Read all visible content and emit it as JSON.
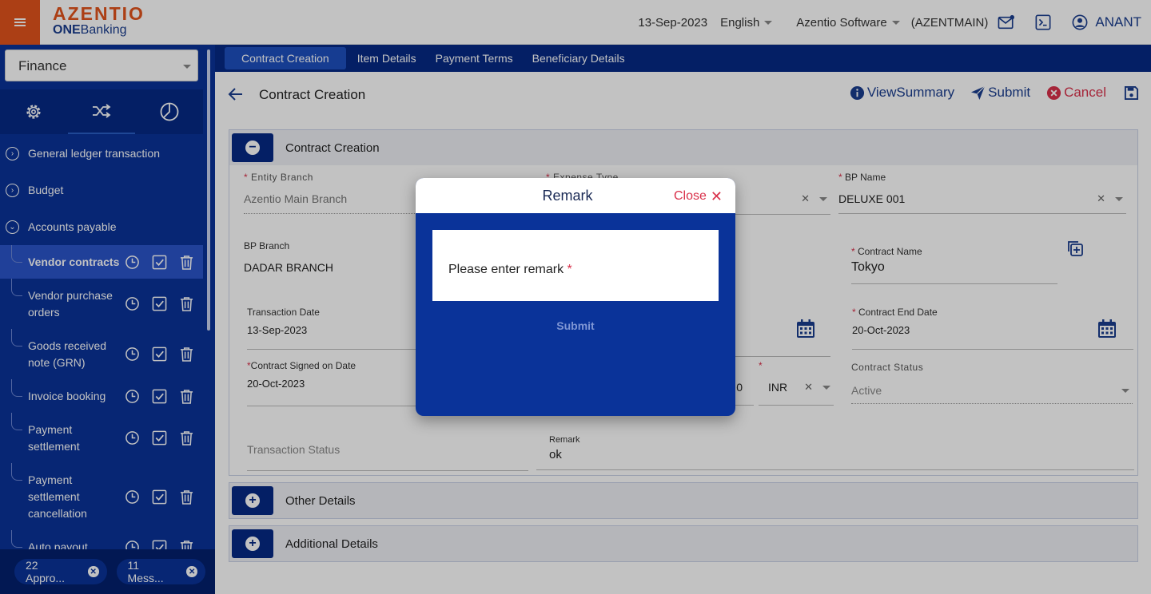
{
  "header": {
    "brand": "AZENTIO",
    "brand_sub_bold": "ONE",
    "brand_sub": "Banking",
    "date": "13-Sep-2023",
    "language": "English",
    "company": "Azentio Software",
    "company_code": "(AZENTMAIN)",
    "user": "ANANT"
  },
  "sidebar": {
    "module": "Finance",
    "groups": [
      {
        "label": "General ledger transaction"
      },
      {
        "label": "Budget"
      },
      {
        "label": "Accounts payable"
      }
    ],
    "items": [
      {
        "label": "Vendor contracts"
      },
      {
        "label": "Vendor purchase orders"
      },
      {
        "label": "Goods received note (GRN)"
      },
      {
        "label": "Invoice booking"
      },
      {
        "label": "Payment settlement"
      },
      {
        "label": "Payment settlement cancellation"
      },
      {
        "label": "Auto payout"
      }
    ],
    "chips": [
      {
        "label": "22 Appro..."
      },
      {
        "label": "11 Mess..."
      }
    ]
  },
  "tabs": [
    "Contract Creation",
    "Item Details",
    "Payment Terms",
    "Beneficiary Details"
  ],
  "page": {
    "title": "Contract Creation",
    "actions": {
      "view_summary": "ViewSummary",
      "submit": "Submit",
      "cancel": "Cancel"
    }
  },
  "section": {
    "title": "Contract Creation",
    "fields": {
      "entity_branch": {
        "label": "Entity Branch",
        "value": "Azentio Main Branch"
      },
      "expense_type": {
        "label": "Expense Type"
      },
      "bp_name": {
        "label": "BP Name",
        "value": "DELUXE 001"
      },
      "bp_branch": {
        "label": "BP Branch",
        "value": "DADAR BRANCH"
      },
      "contract_name": {
        "label": "Contract Name",
        "value": "Tokyo"
      },
      "transaction_date": {
        "label": "Transaction Date",
        "value": "13-Sep-2023"
      },
      "contract_end_date": {
        "label": "Contract End Date",
        "value": "20-Oct-2023"
      },
      "contract_signed_date": {
        "label": "Contract Signed on Date",
        "value": "20-Oct-2023"
      },
      "amount_partial": {
        "value": "0"
      },
      "currency": {
        "value": "INR"
      },
      "contract_status": {
        "label": "Contract Status",
        "value": "Active"
      },
      "transaction_status": {
        "label": "Transaction Status"
      },
      "remark": {
        "label": "Remark",
        "value": "ok"
      }
    }
  },
  "other_section": {
    "title": "Other Details"
  },
  "additional_section": {
    "title": "Additional Details"
  },
  "modal": {
    "title": "Remark",
    "close": "Close",
    "field_label": "Please enter remark",
    "submit": "Submit"
  },
  "colors": {
    "accent_orange": "#e2541c",
    "navy": "#062a85",
    "sidebar_blue": "#0a3399",
    "danger": "#d9304a"
  }
}
